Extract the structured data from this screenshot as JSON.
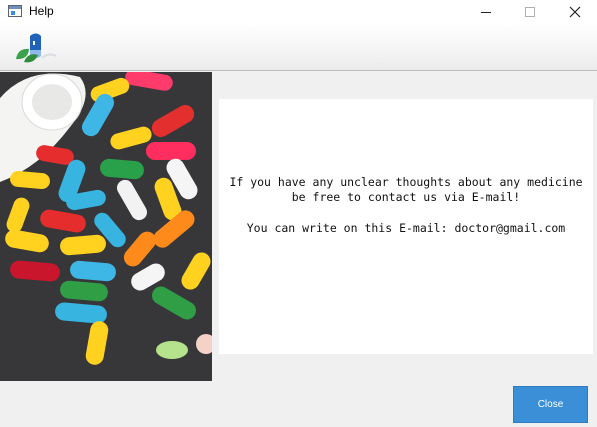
{
  "window": {
    "title": "Help",
    "app_icon": "window-icon"
  },
  "controls": {
    "minimize_icon": "minimize-icon",
    "maximize_icon": "maximize-icon",
    "close_icon": "close-icon"
  },
  "toolbar": {
    "logo_icon": "pharmacy-logo-icon"
  },
  "image": {
    "subject": "pills-photo"
  },
  "message": {
    "line1": "If you have any unclear thoughts about any medicine",
    "line2": "be free to contact us via E-mail!",
    "line3": "You can write on this E-mail: doctor@gmail.com"
  },
  "footer": {
    "close_label": "Close"
  },
  "colors": {
    "accent": "#3b8fd6",
    "panel": "#ffffff",
    "background": "#f0f0f0"
  }
}
